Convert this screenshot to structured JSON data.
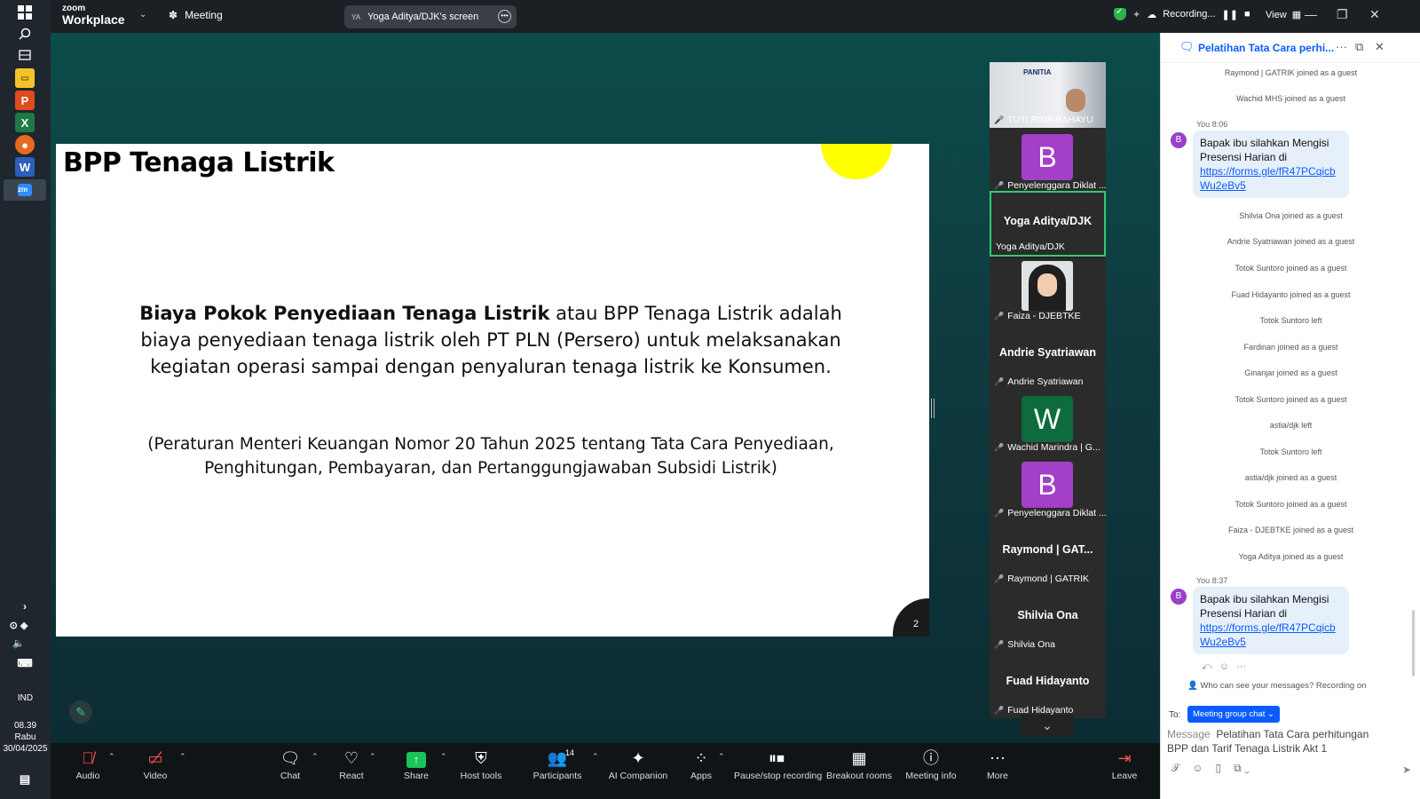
{
  "taskbar": {
    "lang": "IND",
    "time": "08.39",
    "day": "Rabu",
    "date": "30/04/2025"
  },
  "topbar": {
    "logo_small": "zoom",
    "logo_big": "Workplace",
    "meeting_label": "Meeting",
    "screen_initials": "YA",
    "screen_label": "Yoga Aditya/DJK's screen",
    "recording_label": "Recording...",
    "view_label": "View"
  },
  "slide": {
    "title": "BPP Tenaga Listrik",
    "body_bold": "Biaya Pokok Penyediaan Tenaga Listrik",
    "body_rest": " atau BPP Tenaga Listrik adalah biaya penyediaan tenaga listrik oleh PT PLN (Persero) untuk melaksanakan kegiatan operasi sampai dengan penyaluran tenaga listrik ke Konsumen.",
    "reference": "(Peraturan Menteri Keuangan Nomor 20 Tahun 2025 tentang Tata Cara Penyediaan, Penghitungan, Pembayaran, dan Pertanggungjawaban Subsidi Listrik)",
    "page_number": "2",
    "accent_color": "#ffff00"
  },
  "gallery": {
    "banner_text": "PANITIA",
    "tiles": [
      {
        "name": "TUTI RINA RAHAYU",
        "kind": "banner"
      },
      {
        "name": "Penyelenggara Diklat ...",
        "kind": "letter",
        "letter": "B",
        "color": "#a43fc8"
      },
      {
        "name": "Yoga Aditya/DJK",
        "center": "Yoga Aditya/DJK",
        "kind": "active"
      },
      {
        "name": "Faiza - DJEBTKE",
        "kind": "photo"
      },
      {
        "name": "Andrie Syatriawan",
        "center": "Andrie Syatriawan",
        "kind": "text"
      },
      {
        "name": "Wachid Marindra | G...",
        "kind": "letter",
        "letter": "W",
        "color": "#0e6b3d"
      },
      {
        "name": "Penyelenggara Diklat ...",
        "kind": "letter",
        "letter": "B",
        "color": "#a43fc8"
      },
      {
        "name": "Raymond | GATRIK",
        "center": "Raymond | GAT...",
        "kind": "text"
      },
      {
        "name": "Shilvia Ona",
        "center": "Shilvia Ona",
        "kind": "text"
      },
      {
        "name": "Fuad Hidayanto",
        "center": "Fuad Hidayanto",
        "kind": "text"
      }
    ]
  },
  "chat": {
    "title": "Pelatihan Tata Cara perhi...",
    "sys_top": [
      "Raymond | GATRIK joined as a guest",
      "Wachid MHS joined as a guest"
    ],
    "msg1_label": "You 8:06",
    "msg_avatar": "B",
    "msg1_text": "Bapak ibu silahkan Mengisi Presensi Harian di",
    "msg1_link": "https://forms.gle/fR47PCqicbWu2eBv5",
    "sys_mid": [
      "Shilvia Ona joined as a guest",
      "Andrie Syatriawan joined as a guest",
      "Totok Suntoro joined as a guest",
      "Fuad Hidayanto joined as a guest",
      "Totok Suntoro left",
      "Fardinan joined as a guest",
      "Ginanjar joined as a guest",
      "Totok Suntoro joined as a guest",
      "astia/djk left",
      "Totok Suntoro left",
      "astia/djk joined as a guest",
      "Totok Suntoro joined as a guest",
      "Faiza - DJEBTKE joined as a guest",
      "Yoga Aditya joined as a guest"
    ],
    "msg2_label": "You 8:37",
    "msg2_text": "Bapak ibu silahkan Mengisi Presensi Harian di",
    "msg2_link": "https://forms.gle/fR47PCqicbWu2eBv5",
    "who_can_see": "Who can see your messages? Recording on",
    "to_label": "To:",
    "to_value": "Meeting group chat",
    "compose_placeholder": "Message",
    "compose_value": "Pelatihan Tata Cara perhitungan BPP dan Tarif Tenaga Listrik Akt 1"
  },
  "toolbar": {
    "audio": "Audio",
    "video": "Video",
    "chat": "Chat",
    "react": "React",
    "share": "Share",
    "host_tools": "Host tools",
    "participants": "Participants",
    "participants_count": "14",
    "ai_companion": "AI Companion",
    "apps": "Apps",
    "pause_stop": "Pause/stop recording",
    "breakout": "Breakout rooms",
    "meeting_info": "Meeting info",
    "more": "More",
    "leave": "Leave"
  }
}
